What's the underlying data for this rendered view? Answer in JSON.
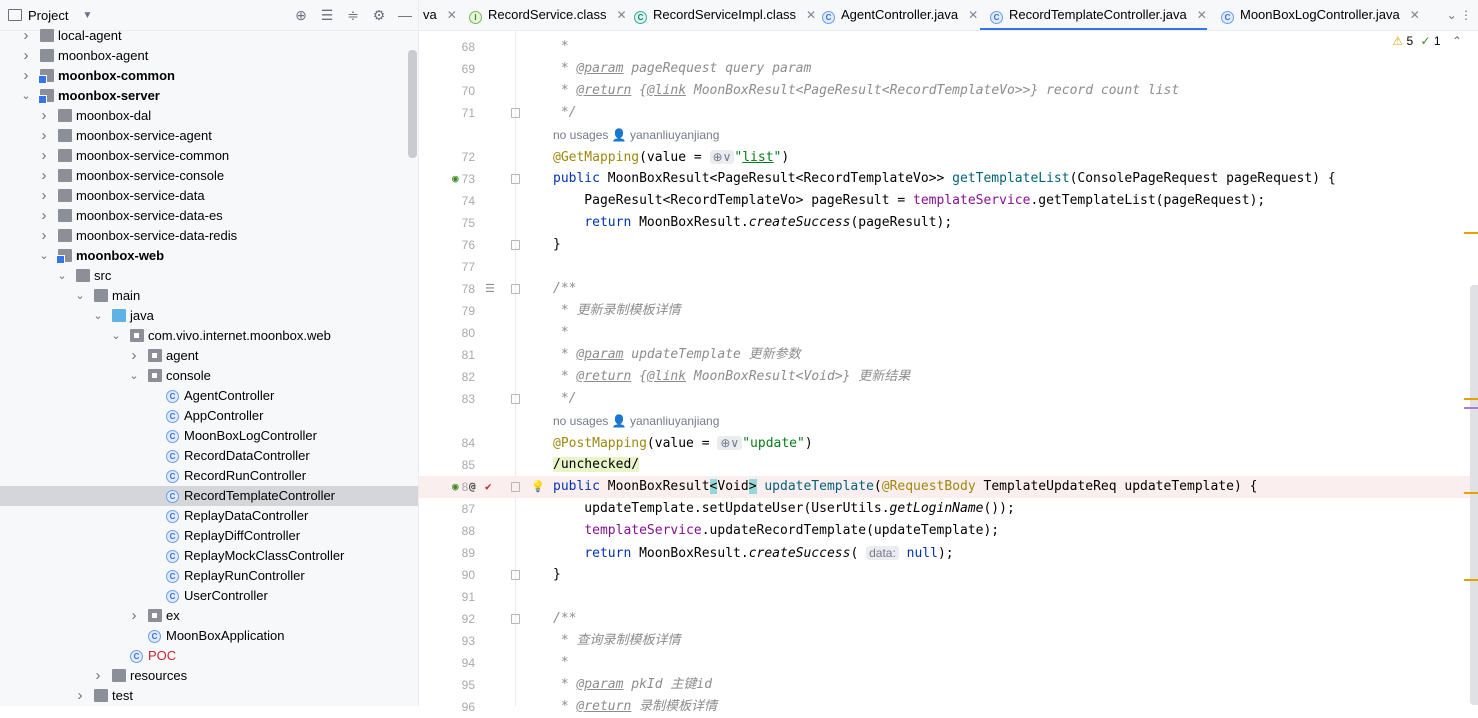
{
  "project": {
    "title": "Project",
    "tree": [
      {
        "label": "local-agent",
        "indent": 0,
        "arrow": "right",
        "icon": "folder",
        "bold": false
      },
      {
        "label": "moonbox-agent",
        "indent": 0,
        "arrow": "right",
        "icon": "folder",
        "bold": false
      },
      {
        "label": "moonbox-common",
        "indent": 0,
        "arrow": "right",
        "icon": "module",
        "bold": true
      },
      {
        "label": "moonbox-server",
        "indent": 0,
        "arrow": "down",
        "icon": "module",
        "bold": true
      },
      {
        "label": "moonbox-dal",
        "indent": 1,
        "arrow": "right",
        "icon": "folder",
        "bold": false
      },
      {
        "label": "moonbox-service-agent",
        "indent": 1,
        "arrow": "right",
        "icon": "folder",
        "bold": false
      },
      {
        "label": "moonbox-service-common",
        "indent": 1,
        "arrow": "right",
        "icon": "folder",
        "bold": false
      },
      {
        "label": "moonbox-service-console",
        "indent": 1,
        "arrow": "right",
        "icon": "folder",
        "bold": false
      },
      {
        "label": "moonbox-service-data",
        "indent": 1,
        "arrow": "right",
        "icon": "folder",
        "bold": false
      },
      {
        "label": "moonbox-service-data-es",
        "indent": 1,
        "arrow": "right",
        "icon": "folder",
        "bold": false
      },
      {
        "label": "moonbox-service-data-redis",
        "indent": 1,
        "arrow": "right",
        "icon": "folder",
        "bold": false
      },
      {
        "label": "moonbox-web",
        "indent": 1,
        "arrow": "down",
        "icon": "module",
        "bold": true
      },
      {
        "label": "src",
        "indent": 2,
        "arrow": "down",
        "icon": "folder",
        "bold": false
      },
      {
        "label": "main",
        "indent": 3,
        "arrow": "down",
        "icon": "folder",
        "bold": false
      },
      {
        "label": "java",
        "indent": 4,
        "arrow": "down",
        "icon": "folder-blue",
        "bold": false
      },
      {
        "label": "com.vivo.internet.moonbox.web",
        "indent": 5,
        "arrow": "down",
        "icon": "pkg",
        "bold": false
      },
      {
        "label": "agent",
        "indent": 6,
        "arrow": "right",
        "icon": "pkg",
        "bold": false
      },
      {
        "label": "console",
        "indent": 6,
        "arrow": "down",
        "icon": "pkg",
        "bold": false
      },
      {
        "label": "AgentController",
        "indent": 7,
        "arrow": "",
        "icon": "class",
        "bold": false
      },
      {
        "label": "AppController",
        "indent": 7,
        "arrow": "",
        "icon": "class",
        "bold": false
      },
      {
        "label": "MoonBoxLogController",
        "indent": 7,
        "arrow": "",
        "icon": "class",
        "bold": false
      },
      {
        "label": "RecordDataController",
        "indent": 7,
        "arrow": "",
        "icon": "class",
        "bold": false
      },
      {
        "label": "RecordRunController",
        "indent": 7,
        "arrow": "",
        "icon": "class",
        "bold": false
      },
      {
        "label": "RecordTemplateController",
        "indent": 7,
        "arrow": "",
        "icon": "class",
        "bold": false,
        "selected": true
      },
      {
        "label": "ReplayDataController",
        "indent": 7,
        "arrow": "",
        "icon": "class",
        "bold": false
      },
      {
        "label": "ReplayDiffController",
        "indent": 7,
        "arrow": "",
        "icon": "class",
        "bold": false
      },
      {
        "label": "ReplayMockClassController",
        "indent": 7,
        "arrow": "",
        "icon": "class",
        "bold": false
      },
      {
        "label": "ReplayRunController",
        "indent": 7,
        "arrow": "",
        "icon": "class",
        "bold": false
      },
      {
        "label": "UserController",
        "indent": 7,
        "arrow": "",
        "icon": "class",
        "bold": false
      },
      {
        "label": "ex",
        "indent": 6,
        "arrow": "right",
        "icon": "pkg",
        "bold": false
      },
      {
        "label": "MoonBoxApplication",
        "indent": 6,
        "arrow": "",
        "icon": "class",
        "bold": false
      },
      {
        "label": "POC",
        "indent": 5,
        "arrow": "",
        "icon": "class",
        "bold": false,
        "color": "#c7222d"
      },
      {
        "label": "resources",
        "indent": 4,
        "arrow": "right",
        "icon": "res",
        "bold": false
      },
      {
        "label": "test",
        "indent": 3,
        "arrow": "right",
        "icon": "folder",
        "bold": false
      }
    ]
  },
  "tabs": [
    {
      "label": "va",
      "icon": "",
      "active": false
    },
    {
      "label": "RecordService.class",
      "icon": "i",
      "active": false
    },
    {
      "label": "RecordServiceImpl.class",
      "icon": "ct",
      "active": false
    },
    {
      "label": "AgentController.java",
      "icon": "c",
      "active": false
    },
    {
      "label": "RecordTemplateController.java",
      "icon": "c",
      "active": true
    },
    {
      "label": "MoonBoxLogController.java",
      "icon": "c",
      "active": false
    }
  ],
  "inspections": {
    "warnings": "5",
    "ok": "1"
  },
  "code_lines": [
    {
      "n": "68",
      "html": " <span class=\"cm\">*</span>"
    },
    {
      "n": "69",
      "html": " <span class=\"cm\">* <span class=\"tag\">@param</span> pageRequest query param</span>"
    },
    {
      "n": "70",
      "html": " <span class=\"cm\">* <span class=\"tag\">@return</span> {<span class=\"tag\">@link</span> MoonBoxResult&lt;PageResult&lt;RecordTemplateVo&gt;&gt;} record count list</span>"
    },
    {
      "n": "71",
      "html": " <span class=\"cm\">*/</span>",
      "fold": true
    },
    {
      "n": "",
      "inlay": "no usages    👤 yananliuyanjiang"
    },
    {
      "n": "72",
      "html": "<span class=\"ann\">@GetMapping</span>(value = <span class=\"hint\">⊕∨</span><span class=\"str\">\"<u>list</u>\"</span>)"
    },
    {
      "n": "73",
      "html": "<span class=\"k\">public</span> MoonBoxResult&lt;PageResult&lt;RecordTemplateVo&gt;&gt; <span class=\"mth\">getTemplateList</span>(ConsolePageRequest pageRequest) {",
      "fold": true,
      "gicon": "bean"
    },
    {
      "n": "74",
      "html": "    PageResult&lt;RecordTemplateVo&gt; pageResult = <span class=\"fld\">templateService</span>.getTemplateList(pageRequest);"
    },
    {
      "n": "75",
      "html": "    <span class=\"k\">return</span> MoonBoxResult.<span class=\"it\">createSuccess</span>(pageResult);"
    },
    {
      "n": "76",
      "html": "}",
      "fold": true
    },
    {
      "n": "77",
      "html": ""
    },
    {
      "n": "78",
      "html": "<span class=\"cm\">/**</span>",
      "fold": true,
      "gicon": "doc"
    },
    {
      "n": "79",
      "html": " <span class=\"cm\">* 更新录制模板详情</span>"
    },
    {
      "n": "80",
      "html": " <span class=\"cm\">*</span>"
    },
    {
      "n": "81",
      "html": " <span class=\"cm\">* <span class=\"tag\">@param</span> updateTemplate 更新参数</span>"
    },
    {
      "n": "82",
      "html": " <span class=\"cm\">* <span class=\"tag\">@return</span> {<span class=\"tag\">@link</span> MoonBoxResult&lt;Void&gt;} 更新结果</span>"
    },
    {
      "n": "83",
      "html": " <span class=\"cm\">*/</span>",
      "fold": true
    },
    {
      "n": "",
      "inlay": "no usages    👤 yananliuyanjiang"
    },
    {
      "n": "84",
      "html": "<span class=\"ann\">@PostMapping</span>(value = <span class=\"hint\">⊕∨</span><span class=\"str\">\"update\"</span>)"
    },
    {
      "n": "85",
      "html": "<span class=\"uncheck\">/unchecked/</span>"
    },
    {
      "n": "86",
      "html": "<span class=\"k\">public</span> MoonBoxResult<span class=\"brace\">&lt;</span>Void<span class=\"brace\">&gt;</span> <span class=\"mth\">updateTemplate</span>(<span class=\"ann\">@RequestBody</span> TemplateUpdateReq updateTemplate) {",
      "fold": true,
      "gicon": "multi",
      "hl": true
    },
    {
      "n": "87",
      "html": "    updateTemplate.setUpdateUser(UserUtils.<span class=\"it\">getLoginName</span>());"
    },
    {
      "n": "88",
      "html": "    <span class=\"fld\">templateService</span>.updateRecordTemplate(updateTemplate);"
    },
    {
      "n": "89",
      "html": "    <span class=\"k\">return</span> MoonBoxResult.<span class=\"it\">createSuccess</span>( <span class=\"hint\">data:</span> <span class=\"k\">null</span>);"
    },
    {
      "n": "90",
      "html": "}",
      "fold": true
    },
    {
      "n": "91",
      "html": ""
    },
    {
      "n": "92",
      "html": "<span class=\"cm\">/**</span>",
      "fold": true
    },
    {
      "n": "93",
      "html": " <span class=\"cm\">* 查询录制模板详情</span>"
    },
    {
      "n": "94",
      "html": " <span class=\"cm\">*</span>"
    },
    {
      "n": "95",
      "html": " <span class=\"cm\">* <span class=\"tag\">@param</span> pkId 主键id</span>"
    },
    {
      "n": "96",
      "html": " <span class=\"cm\">* <span class=\"tag\">@return</span> 录制模板详情</span>"
    }
  ]
}
